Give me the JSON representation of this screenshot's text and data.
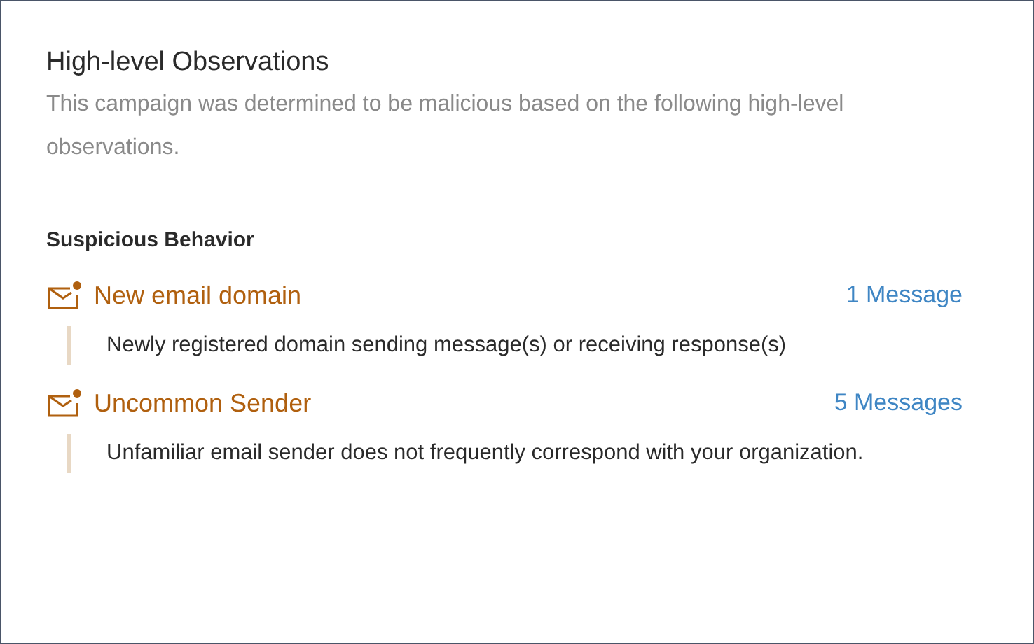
{
  "title": "High-level Observations",
  "description": "This campaign was determined to be malicious based on the following high-level observations.",
  "section": {
    "heading": "Suspicious Behavior",
    "observations": [
      {
        "name": "New email domain",
        "count": "1 Message",
        "detail": "Newly registered domain sending message(s) or receiving response(s)"
      },
      {
        "name": "Uncommon Sender",
        "count": "5 Messages",
        "detail": "Unfamiliar email sender does not frequently correspond with your organization."
      }
    ]
  }
}
